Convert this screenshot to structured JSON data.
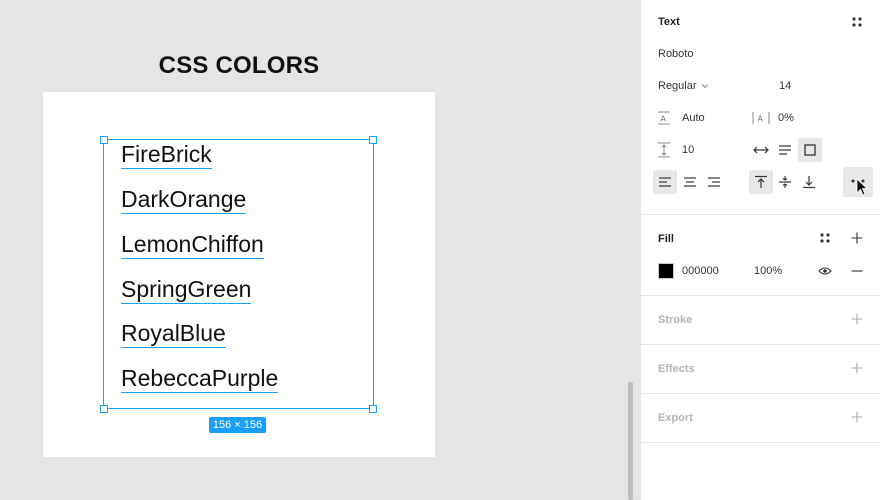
{
  "canvas": {
    "frame_title": "CSS COLORS",
    "colors": [
      "FireBrick",
      "DarkOrange",
      "LemonChiffon",
      "SpringGreen",
      "RoyalBlue",
      "RebeccaPurple"
    ],
    "size_badge": "156 × 156",
    "selection_color": "#18a0fb"
  },
  "panel": {
    "text": {
      "title": "Text",
      "font_family": "Roboto",
      "font_weight": "Regular",
      "font_size": "14",
      "line_height": "Auto",
      "letter_spacing": "0%",
      "paragraph_spacing": "10"
    },
    "fill": {
      "title": "Fill",
      "hex": "000000",
      "opacity": "100%",
      "swatch_color": "#000000"
    },
    "stroke": {
      "title": "Stroke"
    },
    "effects": {
      "title": "Effects"
    },
    "export": {
      "title": "Export"
    }
  }
}
